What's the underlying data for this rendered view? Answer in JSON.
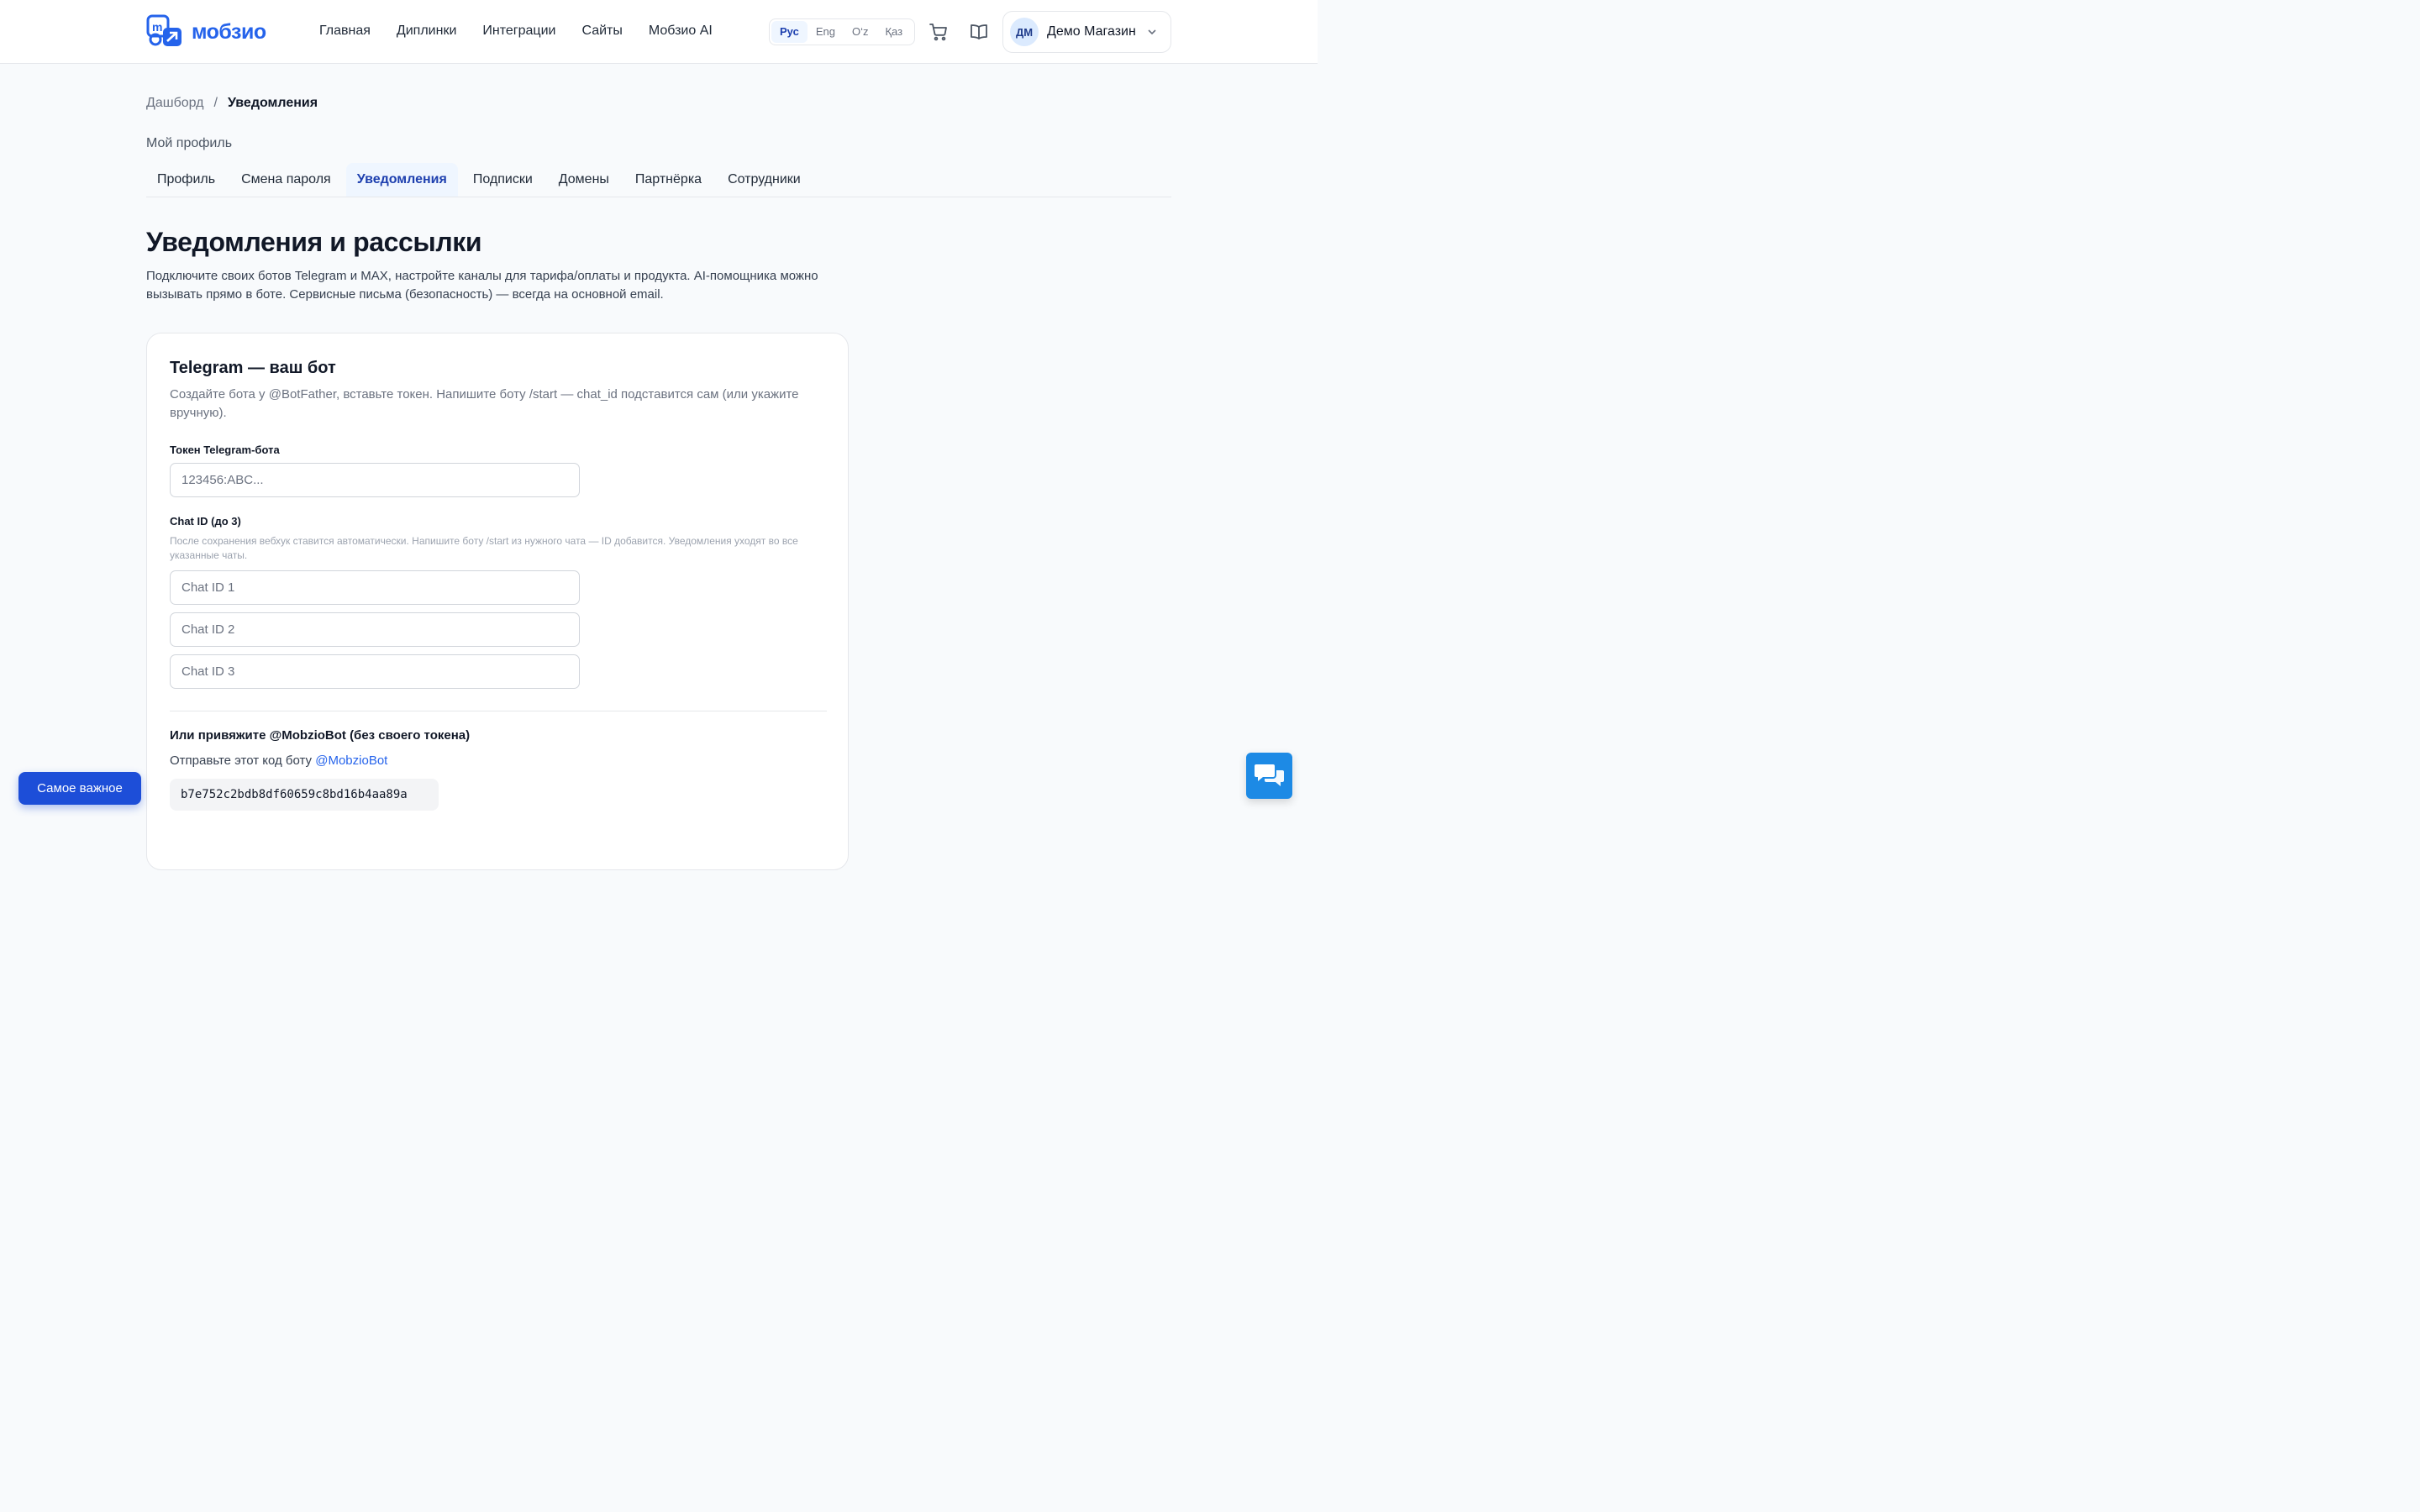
{
  "header": {
    "logo_text": "мобзио",
    "nav": [
      "Главная",
      "Диплинки",
      "Интеграции",
      "Сайты",
      "Мобзио AI"
    ],
    "languages": [
      "Рус",
      "Eng",
      "O‘z",
      "Қаз"
    ],
    "active_language": "Рус",
    "account": {
      "initials": "ДМ",
      "name": "Демо Магазин"
    }
  },
  "breadcrumb": {
    "parent": "Дашборд",
    "separator": "/",
    "current": "Уведомления"
  },
  "section_label": "Мой профиль",
  "tabs": [
    "Профиль",
    "Смена пароля",
    "Уведомления",
    "Подписки",
    "Домены",
    "Партнёрка",
    "Сотрудники"
  ],
  "active_tab": "Уведомления",
  "page": {
    "title": "Уведомления и рассылки",
    "description": "Подключите своих ботов Telegram и MAX, настройте каналы для тарифа/оплаты и продукта. AI-помощника можно вызывать прямо в боте. Сервисные письма (безопасность) — всегда на основной email."
  },
  "telegram_card": {
    "title": "Telegram — ваш бот",
    "description": "Создайте бота у @BotFather, вставьте токен. Напишите боту /start — chat_id подставится сам (или укажите вручную).",
    "token_label": "Токен Telegram-бота",
    "token_placeholder": "123456:ABC...",
    "chat_label": "Chat ID (до 3)",
    "chat_hint": "После сохранения вебхук ставится автоматически. Напишите боту /start из нужного чата — ID добавится. Уведомления уходят во все указанные чаты.",
    "chat_placeholders": [
      "Chat ID 1",
      "Chat ID 2",
      "Chat ID 3"
    ],
    "bind_title": "Или привяжите @MobzioBot (без своего токена)",
    "bind_text": "Отправьте этот код боту",
    "bind_bot": "@MobzioBot",
    "bind_code": "b7e752c2bdb8df60659c8bd16b4aa89a"
  },
  "floating": {
    "important_label": "Самое важное"
  },
  "icons": {
    "cart": "cart-icon",
    "docs": "book-icon",
    "chevron": "chevron-down-icon",
    "chat": "chat-bubbles-icon"
  },
  "colors": {
    "accent": "#2563eb",
    "accent_dark": "#1d4ed8",
    "chat": "#1d8ae5"
  }
}
